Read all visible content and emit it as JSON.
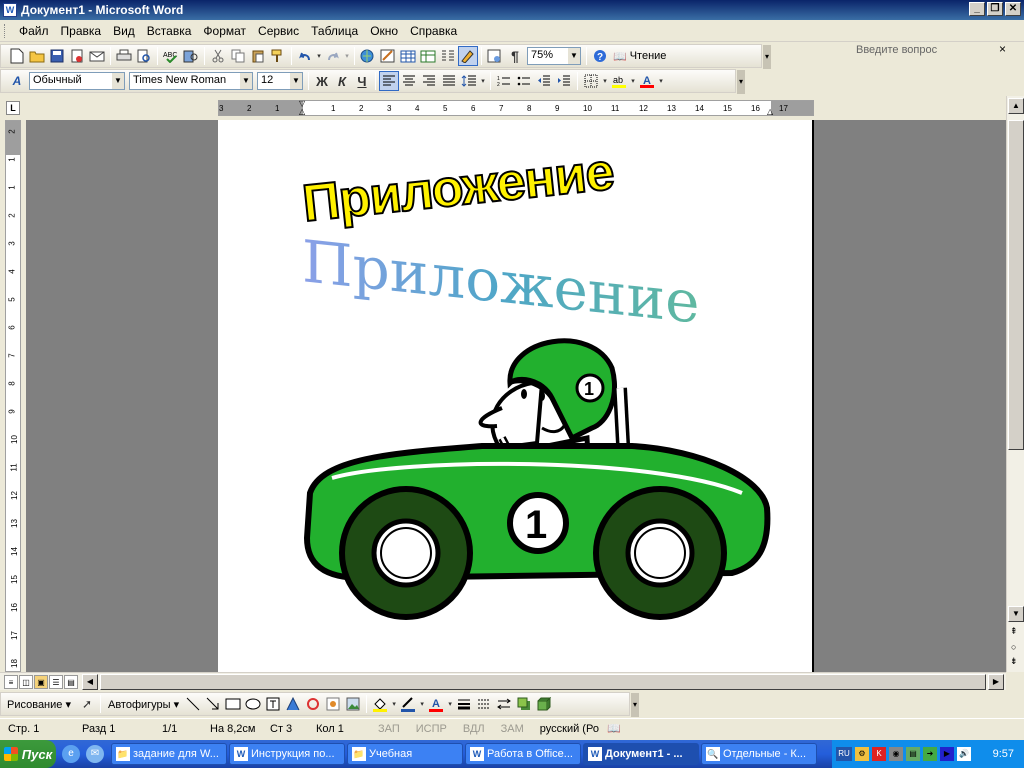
{
  "window": {
    "title": "Документ1 - Microsoft Word",
    "app_icon": "W",
    "min_glyph": "_",
    "restore_glyph": "❐",
    "close_glyph": "✕"
  },
  "menu": {
    "items": [
      "Файл",
      "Правка",
      "Вид",
      "Вставка",
      "Формат",
      "Сервис",
      "Таблица",
      "Окно",
      "Справка"
    ],
    "help_placeholder": "Введите вопрос",
    "help_close": "×"
  },
  "standard_toolbar": {
    "zoom": "75%",
    "reading_label": "Чтение",
    "pilcrow": "¶"
  },
  "format_toolbar": {
    "style": "Обычный",
    "font": "Times New Roman",
    "size": "12",
    "bold": "Ж",
    "italic": "К",
    "underline": "Ч",
    "highlight_color": "#FFFF00",
    "font_color": "#FF0000"
  },
  "ruler": {
    "corner": "L",
    "h_ticks": [
      "3",
      "2",
      "1",
      "1",
      "2",
      "3",
      "4",
      "5",
      "6",
      "7",
      "8",
      "9",
      "10",
      "11",
      "12",
      "13",
      "14",
      "15",
      "16",
      "17"
    ],
    "v_ticks": [
      "2",
      "1",
      "1",
      "2",
      "3",
      "4",
      "5",
      "6",
      "7",
      "8",
      "9",
      "10",
      "11",
      "12",
      "13",
      "14",
      "15",
      "16",
      "17",
      "18"
    ]
  },
  "document": {
    "wordart_1": "Приложение",
    "wordart_2": "Приложение",
    "car_number": "1",
    "helmet_number": "1",
    "car_color": "#22B02E",
    "wheel_color": "#1E4A14"
  },
  "drawing_toolbar": {
    "draw_label": "Рисование ▾",
    "autoshapes_label": "Автофигуры ▾"
  },
  "status": {
    "page": "Стр. 1",
    "section": "Разд 1",
    "pages": "1/1",
    "at": "На 8,2см",
    "line": "Ст 3",
    "col": "Кол 1",
    "rec": "ЗАП",
    "trk": "ИСПР",
    "ext": "ВДЛ",
    "ovr": "ЗАМ",
    "language": "русский (Ро"
  },
  "taskbar": {
    "start_label": "Пуск",
    "tasks": [
      {
        "label": "задание для W...",
        "icon": "📁"
      },
      {
        "label": "Инструкция по...",
        "icon": "W"
      },
      {
        "label": "Учебная",
        "icon": "📁"
      },
      {
        "label": "Работа в Office...",
        "icon": "W"
      },
      {
        "label": "Документ1 - ...",
        "icon": "W"
      },
      {
        "label": "Отдельные - К...",
        "icon": "🔍"
      }
    ],
    "tray_lang": "RU",
    "clock": "9:57"
  }
}
